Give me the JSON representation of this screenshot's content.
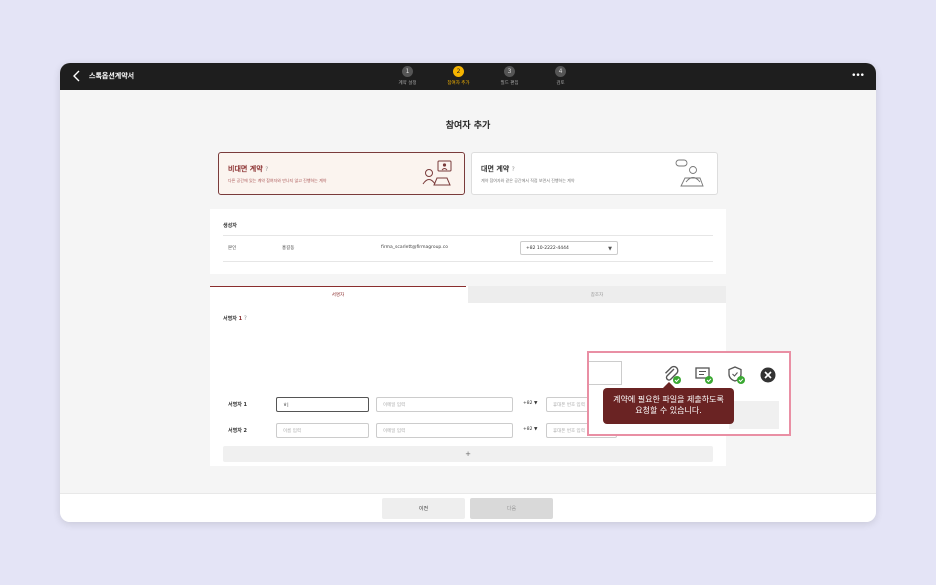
{
  "header": {
    "title": "스톡옵션계약서",
    "steps": [
      {
        "num": "1",
        "label": "계약 설정"
      },
      {
        "num": "2",
        "label": "참여자 추가"
      },
      {
        "num": "3",
        "label": "필드 편집"
      },
      {
        "num": "4",
        "label": "검토"
      }
    ],
    "more": "•••"
  },
  "page_title": "참여자 추가",
  "contract_types": {
    "remote": {
      "title": "비대면 계약",
      "help": "?",
      "desc": "다른 공간에 있는 계약 참여자와 만나지 않고 진행하는 계약"
    },
    "inperson": {
      "title": "대면 계약",
      "help": "?",
      "desc": "계약 참여자와 같은 공간에서 직접 보면서 진행하는 계약"
    }
  },
  "creator": {
    "section_label": "생성자",
    "role": "본인",
    "name": "홍길동",
    "email": "firma_scarlett@firmagroup.co",
    "phone": "+82 10-2222-4444"
  },
  "tabs": {
    "signer": "서명자",
    "reference": "참조자"
  },
  "signers": {
    "section_label": "서명자",
    "count": "1",
    "help": "?",
    "rows": [
      {
        "label": "서명자 1",
        "name_value": "ㅎ|",
        "email_placeholder": "이메일 입력",
        "country_code": "+82",
        "phone_placeholder": "휴대폰 번호 입력"
      },
      {
        "label": "서명자 2",
        "name_placeholder": "이름 입력",
        "email_placeholder": "이메일 입력",
        "country_code": "+82",
        "phone_placeholder": "휴대폰 번호 입력"
      }
    ],
    "add_label": "+"
  },
  "buttons": {
    "prev": "이전",
    "next": "다음"
  },
  "tooltip": {
    "line1": "계약에 필요한 파일을 제출하도록",
    "line2": "요청할 수 있습니다."
  },
  "colors": {
    "accent": "#8a2e2e",
    "step_active": "#f5b400",
    "highlight": "#e98fa4",
    "check": "#3aa832"
  }
}
